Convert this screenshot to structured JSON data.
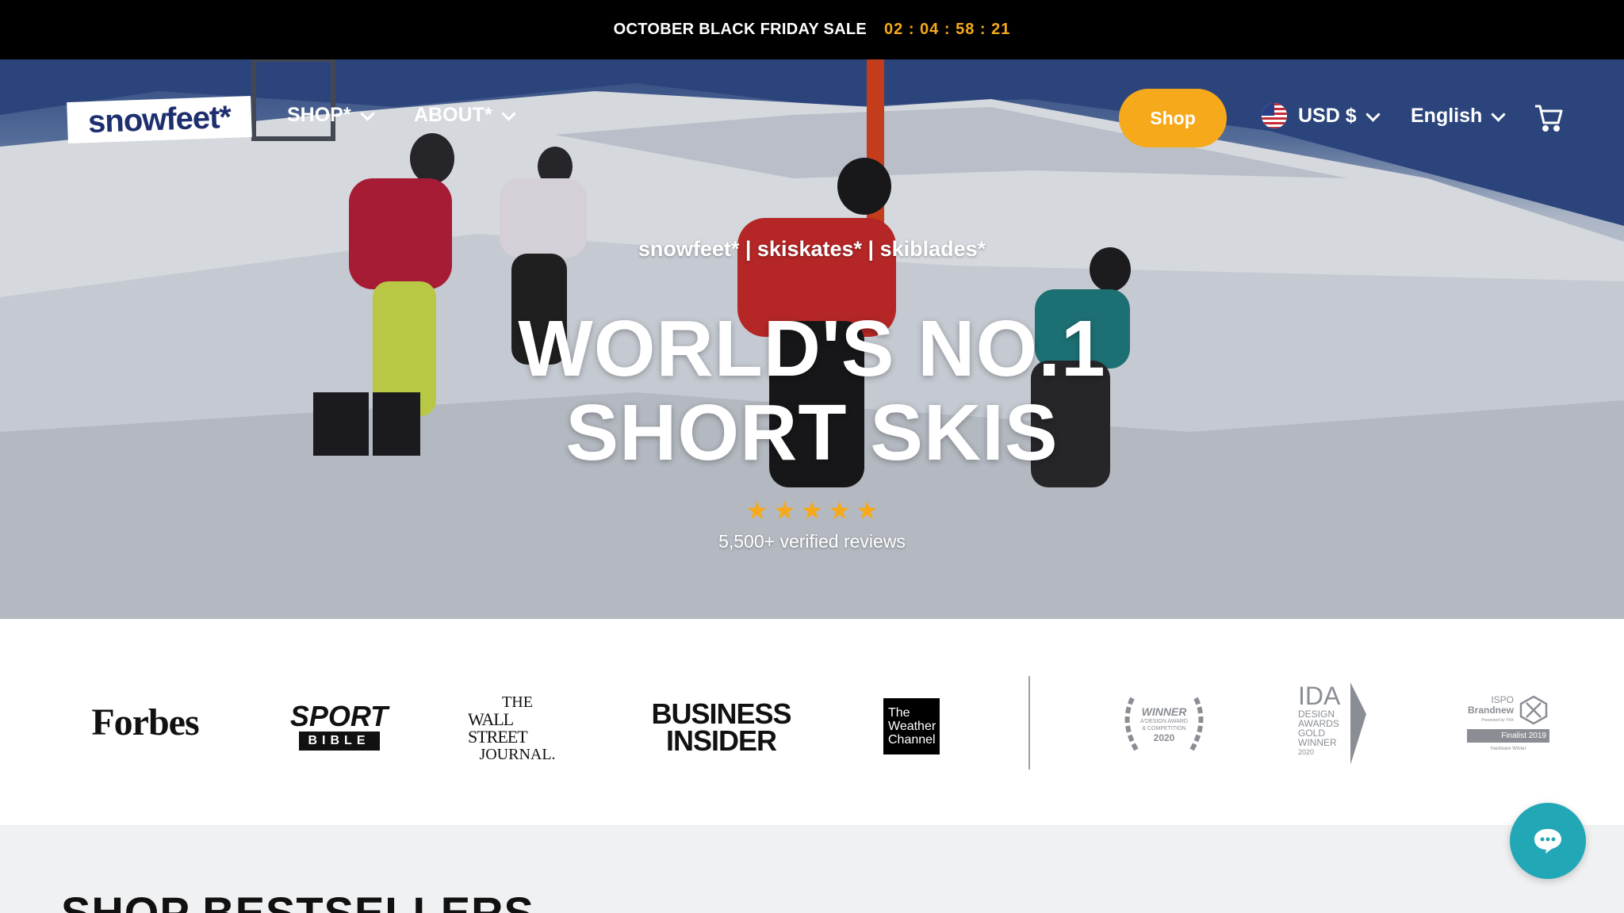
{
  "announcement": {
    "text": "OCTOBER BLACK FRIDAY SALE",
    "countdown": "02 : 04 : 58 : 21"
  },
  "header": {
    "logo_text": "snowfeet*",
    "nav": [
      {
        "label": "SHOP*"
      },
      {
        "label": "ABOUT*"
      }
    ],
    "shop_button": "Shop",
    "currency": "USD $",
    "language": "English"
  },
  "hero": {
    "tagline": "snowfeet* | skiskates* | skiblades*",
    "headline_line1": "WORLD'S NO.1",
    "headline_line2": "SHORT SKIS",
    "rating_stars": 5,
    "reviews_text": "5,500+ verified reviews"
  },
  "press": {
    "forbes": "Forbes",
    "sportbible_top": "SPORT",
    "sportbible_bottom": "BIBLE",
    "wsj_line1": "THE",
    "wsj_line2": "WALL STREET",
    "wsj_line3": "JOURNAL.",
    "bi_line1": "BUSINESS",
    "bi_line2": "INSIDER",
    "weather_line1": "The",
    "weather_line2": "Weather",
    "weather_line3": "Channel",
    "award1_title": "WINNER",
    "award1_sub": "A'DESIGN AWARD & COMPETITION",
    "award1_year": "2020",
    "award2_title": "IDA",
    "award2_sub1": "DESIGN",
    "award2_sub2": "AWARDS",
    "award2_sub3": "GOLD",
    "award2_sub4": "WINNER",
    "award2_year": "2020",
    "award3_title1": "ISPO",
    "award3_title2": "Brandnew",
    "award3_presented": "Presented by YKK",
    "award3_badge": "Finalist 2019",
    "award3_cat": "Hardware Winter"
  },
  "bestsellers": {
    "title": "SHOP BESTSELLERS"
  },
  "colors": {
    "accent": "#f6a91b",
    "chat": "#22a7b6",
    "logo_text": "#1d2f6f"
  },
  "icons": {
    "cart": "cart-icon",
    "chat": "chat-icon",
    "flag": "us-flag-icon",
    "star": "star-icon"
  }
}
